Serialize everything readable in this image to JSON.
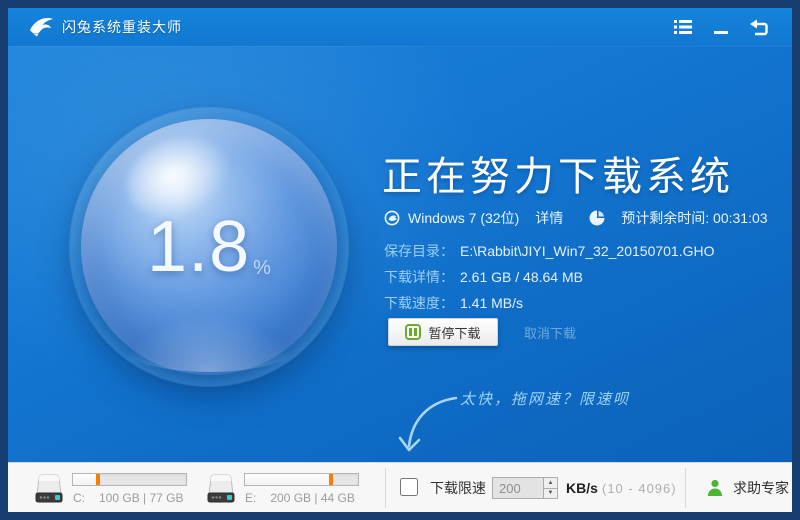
{
  "window": {
    "title": "闪兔系统重装大师"
  },
  "progress": {
    "percent": "1.8",
    "unit": "%"
  },
  "main": {
    "heading": "正在努力下载系统",
    "os_name": "Windows 7 (32位)",
    "details_link": "详情",
    "eta": "预计剩余时间: 00:31:03",
    "rows": [
      {
        "label": "保存目录：",
        "value": "E:\\Rabbit\\JIYI_Win7_32_20150701.GHO"
      },
      {
        "label": "下载详情：",
        "value": "2.61 GB / 48.64 MB"
      },
      {
        "label": "下载速度：",
        "value": "1.41 MB/s"
      }
    ],
    "pause_label": "暂停下载",
    "cancel_label": "取消下载",
    "tip": "太快，拖网速？限速呗"
  },
  "statusbar": {
    "drives": [
      {
        "letter": "C:",
        "info": "100 GB | 77 GB",
        "used_percent": 24
      },
      {
        "letter": "E:",
        "info": "200 GB | 44 GB",
        "used_percent": 78
      }
    ],
    "limit": {
      "label": "下载限速",
      "value": "200",
      "unit": "KB/s",
      "range": "(10 - 4096)",
      "checked": false,
      "spin_up": "▲",
      "spin_down": "▼"
    },
    "help_label": "求助专家"
  },
  "icons": {
    "logo": "rabbit-logo",
    "menu": "menu-list-icon",
    "minimize": "minimize-icon",
    "close": "exit-icon",
    "os": "globe-icon",
    "eta": "timer-icon",
    "pause": "pause-icon",
    "drive": "hard-drive-icon",
    "help": "person-icon"
  },
  "colors": {
    "frame_navy": "#153d6f",
    "background_blue": "#1478d3",
    "label_blue": "#9bcef4",
    "orange_marker": "#ff7a00",
    "pause_green": "#66ad29",
    "help_green": "#4cb335",
    "statusbar_bg": "#f7f7f7"
  }
}
